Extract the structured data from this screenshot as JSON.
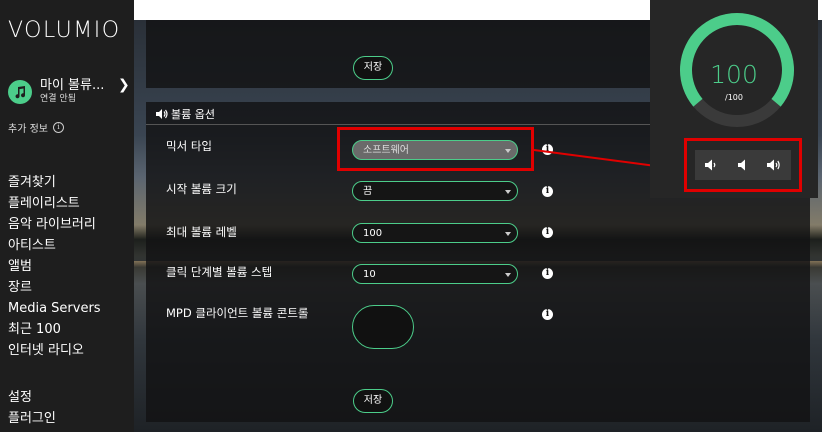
{
  "brand": "VOLUMIO",
  "device": {
    "name": "마이 볼류...",
    "status": "연결 안됨"
  },
  "more_info": "추가 정보",
  "nav_items": [
    "즐겨찾기",
    "플레이리스트",
    "음악 라이브러리",
    "아티스트",
    "앨범",
    "장르",
    "Media Servers",
    "최근 100",
    "인터넷 라디오"
  ],
  "nav_bottom": [
    "설정",
    "플러그인"
  ],
  "save_label": "저장",
  "volume_section": {
    "title": "볼륨 옵션",
    "rows": [
      {
        "label": "믹서 타입",
        "value": "소프트웨어"
      },
      {
        "label": "시작 볼륨 크기",
        "value": "끔"
      },
      {
        "label": "최대 볼륨 레벨",
        "value": "100"
      },
      {
        "label": "클릭 단계별 볼륨 스텝",
        "value": "10"
      },
      {
        "label": "MPD 클라이언트 볼륨 콘트롤",
        "value": ""
      }
    ]
  },
  "volume_popup": {
    "value": "100",
    "max": "/100",
    "level": 1.0
  },
  "colors": {
    "accent": "#4ccd8a",
    "highlight": "#e00000",
    "sidebar": "#1e1e1e"
  },
  "icons": [
    "music-note-icon",
    "chevron-right-icon",
    "info-icon",
    "speaker-icon",
    "volume-down-icon",
    "mute-icon",
    "volume-up-icon"
  ]
}
